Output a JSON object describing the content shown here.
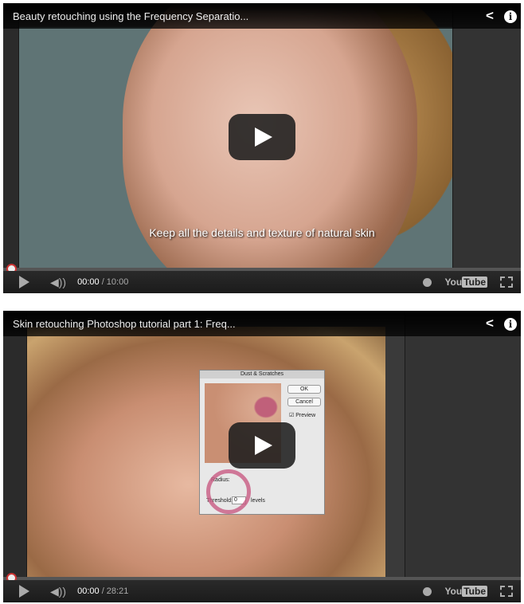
{
  "videos": [
    {
      "title": "Beauty retouching using the Frequency Separatio...",
      "subtitle": "Keep all the details and texture of natural skin",
      "current_time": "00:00",
      "duration": "/ 10:00",
      "progress": 0,
      "logo": {
        "you": "You",
        "tube": "Tube"
      }
    },
    {
      "title": "Skin retouching Photoshop tutorial part 1: Freq...",
      "current_time": "00:00",
      "duration": "/ 28:21",
      "progress": 0,
      "logo": {
        "you": "You",
        "tube": "Tube"
      },
      "dialog": {
        "title": "Dust & Scratches",
        "ok": "OK",
        "cancel": "Cancel",
        "preview": "Preview",
        "radius_label": "Radius:",
        "threshold_label": "Threshold:",
        "threshold_value": "0",
        "threshold_unit": "levels"
      }
    }
  ],
  "icons": {
    "share": "share-icon",
    "info": "info-icon",
    "play": "play-icon",
    "volume": "volume-icon",
    "watch_later": "clock-icon",
    "fullscreen": "fullscreen-icon"
  }
}
